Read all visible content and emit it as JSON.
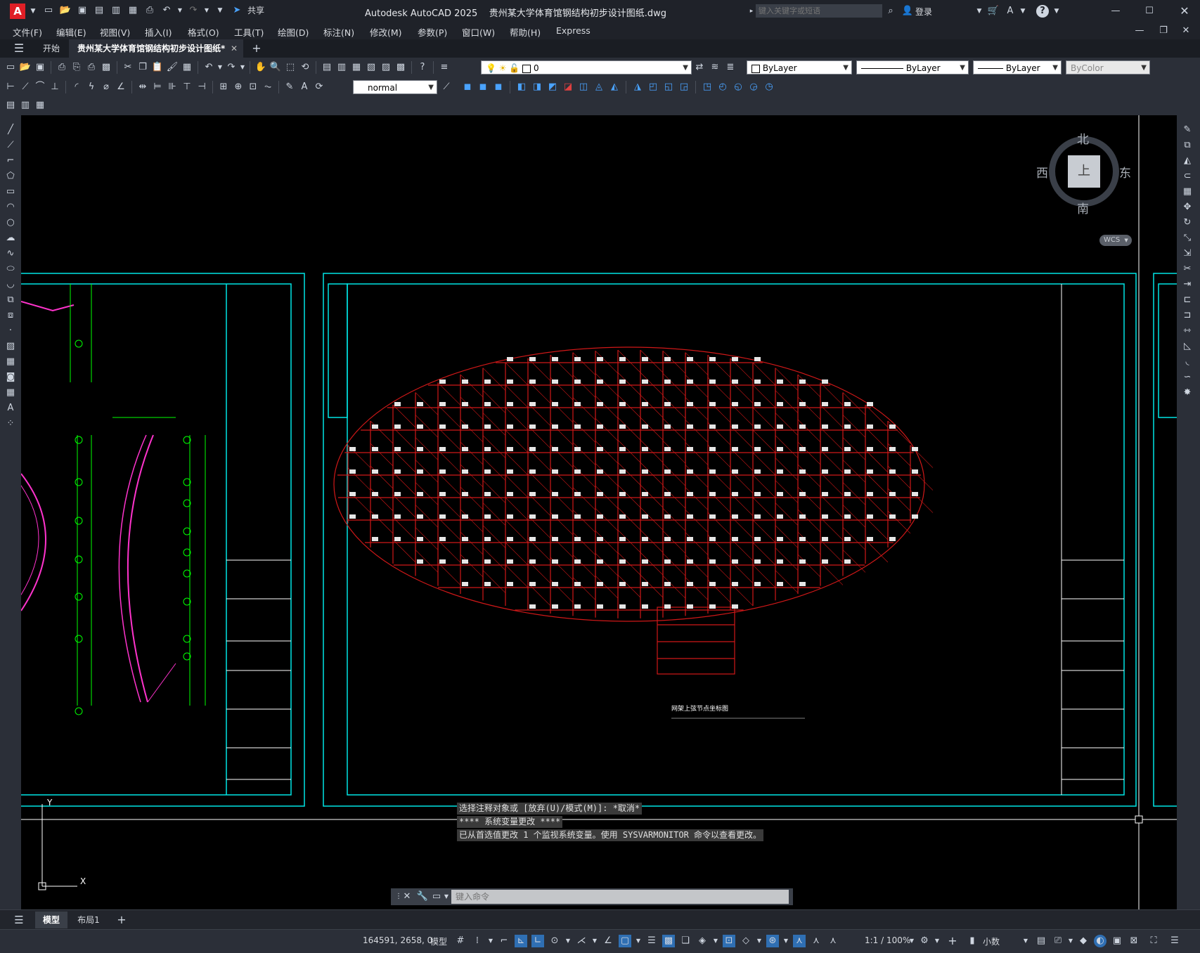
{
  "app": {
    "title": "Autodesk AutoCAD 2025    贵州某大学体育馆钢结构初步设计图纸.dwg",
    "share_label": "共享",
    "search_placeholder": "键入关键字或短语",
    "login_label": "登录"
  },
  "menu": [
    "文件(F)",
    "编辑(E)",
    "视图(V)",
    "插入(I)",
    "格式(O)",
    "工具(T)",
    "绘图(D)",
    "标注(N)",
    "修改(M)",
    "参数(P)",
    "窗口(W)",
    "帮助(H)",
    "Express"
  ],
  "tabs": {
    "start": "开始",
    "active": "贵州某大学体育馆钢结构初步设计图纸*"
  },
  "properties": {
    "layer": "0",
    "color": "ByLayer",
    "linetype": "ByLayer",
    "lineweight": "ByLayer",
    "plotstyle": "ByColor",
    "dimstyle": "normal"
  },
  "viewcube": {
    "north": "北",
    "south": "南",
    "east": "东",
    "west": "西",
    "top": "上",
    "wcs": "WCS"
  },
  "command": {
    "history": [
      "选择注释对象或 [放弃(U)/模式(M)]: *取消*",
      "**** 系统变量更改 ****",
      "已从首选值更改 1 个监视系统变量。使用 SYSVARMONITOR 命令以查看更改。"
    ],
    "placeholder": "键入命令"
  },
  "layout_tabs": [
    "模型",
    "布局1"
  ],
  "status": {
    "coords": "164591, 2658, 0",
    "space": "模型",
    "scale": "1:1 / 100%",
    "units": "小数"
  },
  "drawing": {
    "plan_title": "网架上弦节点坐标图"
  },
  "colors": {
    "accent": "#e01f26",
    "cad_frame": "#00e5e5",
    "member": "#d01818",
    "dimension": "#00ff00",
    "truss": "#ff33cc"
  }
}
